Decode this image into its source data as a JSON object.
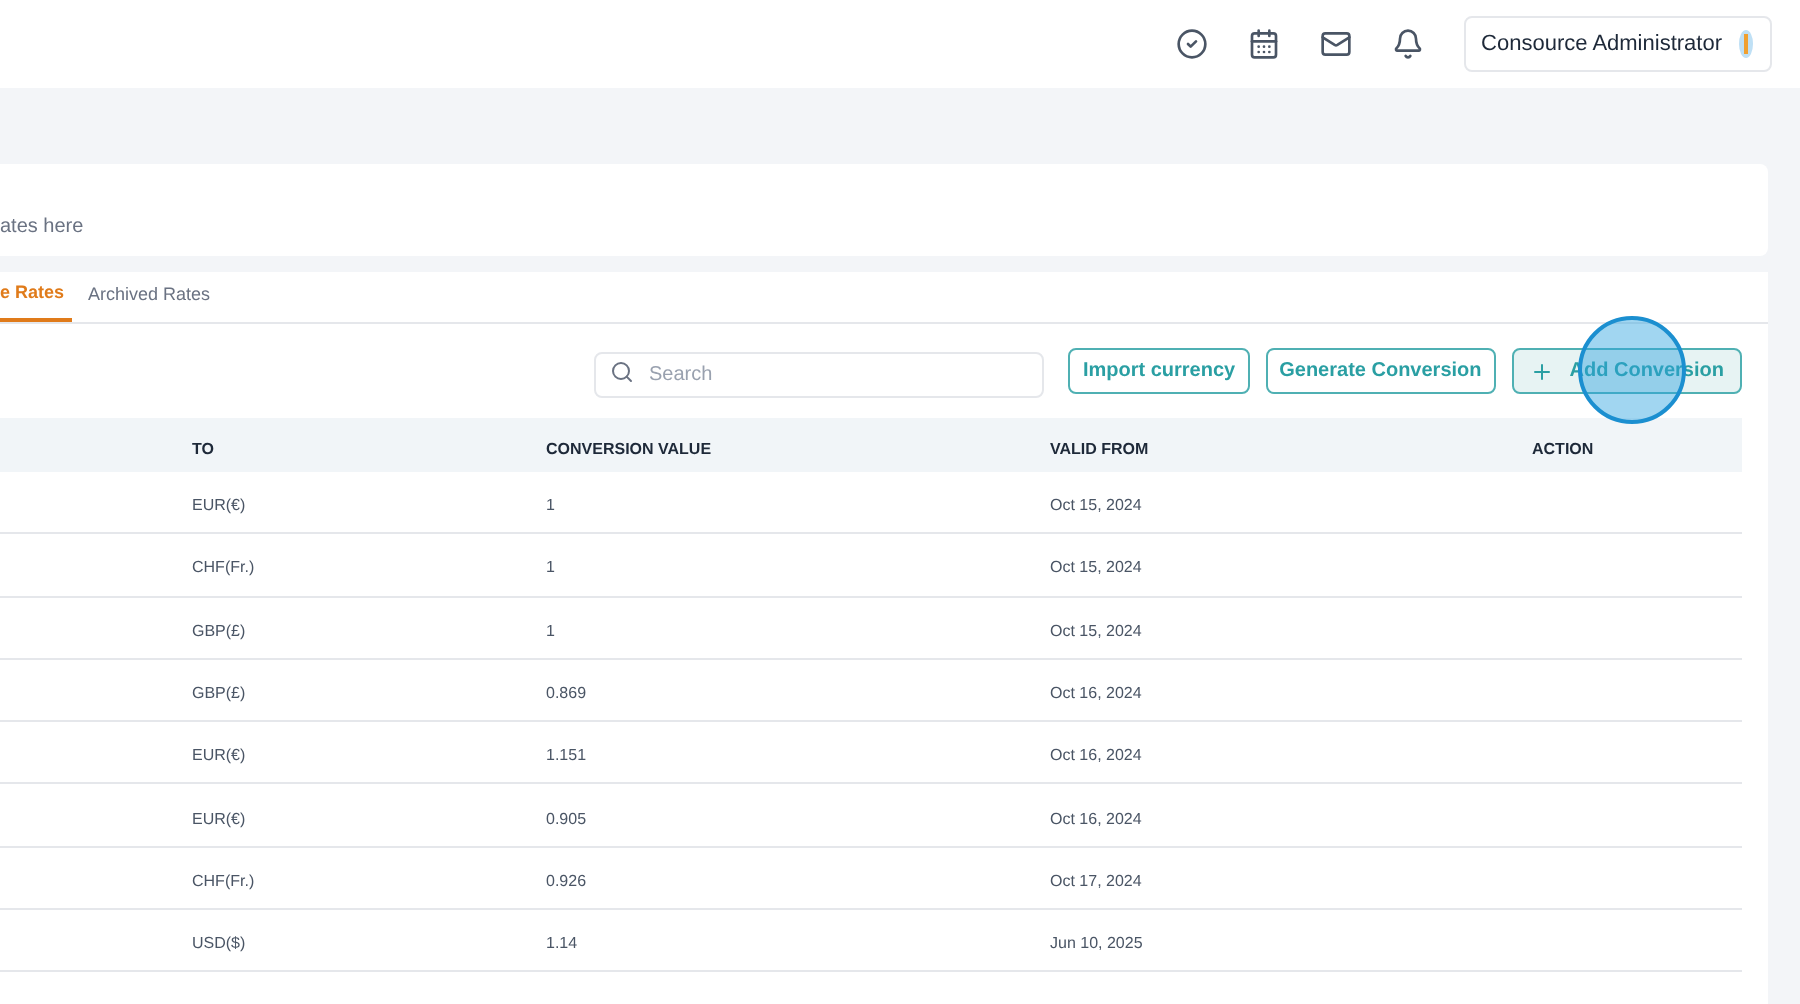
{
  "header": {
    "user": "Consource Administrator"
  },
  "intro": {
    "text": "ates here"
  },
  "tabs": [
    {
      "label": "e Rates",
      "selected": true
    },
    {
      "label": "Archived Rates",
      "selected": false
    }
  ],
  "toolbar": {
    "search": {
      "placeholder": "Search"
    },
    "buttons": [
      {
        "label": "Import currency",
        "kind": "outline"
      },
      {
        "label": "Generate Conversion",
        "kind": "outline"
      },
      {
        "label": "Add Conversion",
        "kind": "add"
      }
    ]
  },
  "table": {
    "columns": [
      "TO",
      "CONVERSION VALUE",
      "VALID FROM",
      "ACTION"
    ],
    "rows": [
      [
        "EUR(€)",
        "1",
        "Oct 15, 2024"
      ],
      [
        "CHF(Fr.)",
        "1",
        "Oct 15, 2024"
      ],
      [
        "GBP(£)",
        "1",
        "Oct 15, 2024"
      ],
      [
        "GBP(£)",
        "0.869",
        "Oct 16, 2024"
      ],
      [
        "EUR(€)",
        "1.151",
        "Oct 16, 2024"
      ],
      [
        "EUR(€)",
        "0.905",
        "Oct 16, 2024"
      ],
      [
        "CHF(Fr.)",
        "0.926",
        "Oct 17, 2024"
      ],
      [
        "USD($)",
        "1.14",
        "Jun 10, 2025"
      ]
    ]
  }
}
